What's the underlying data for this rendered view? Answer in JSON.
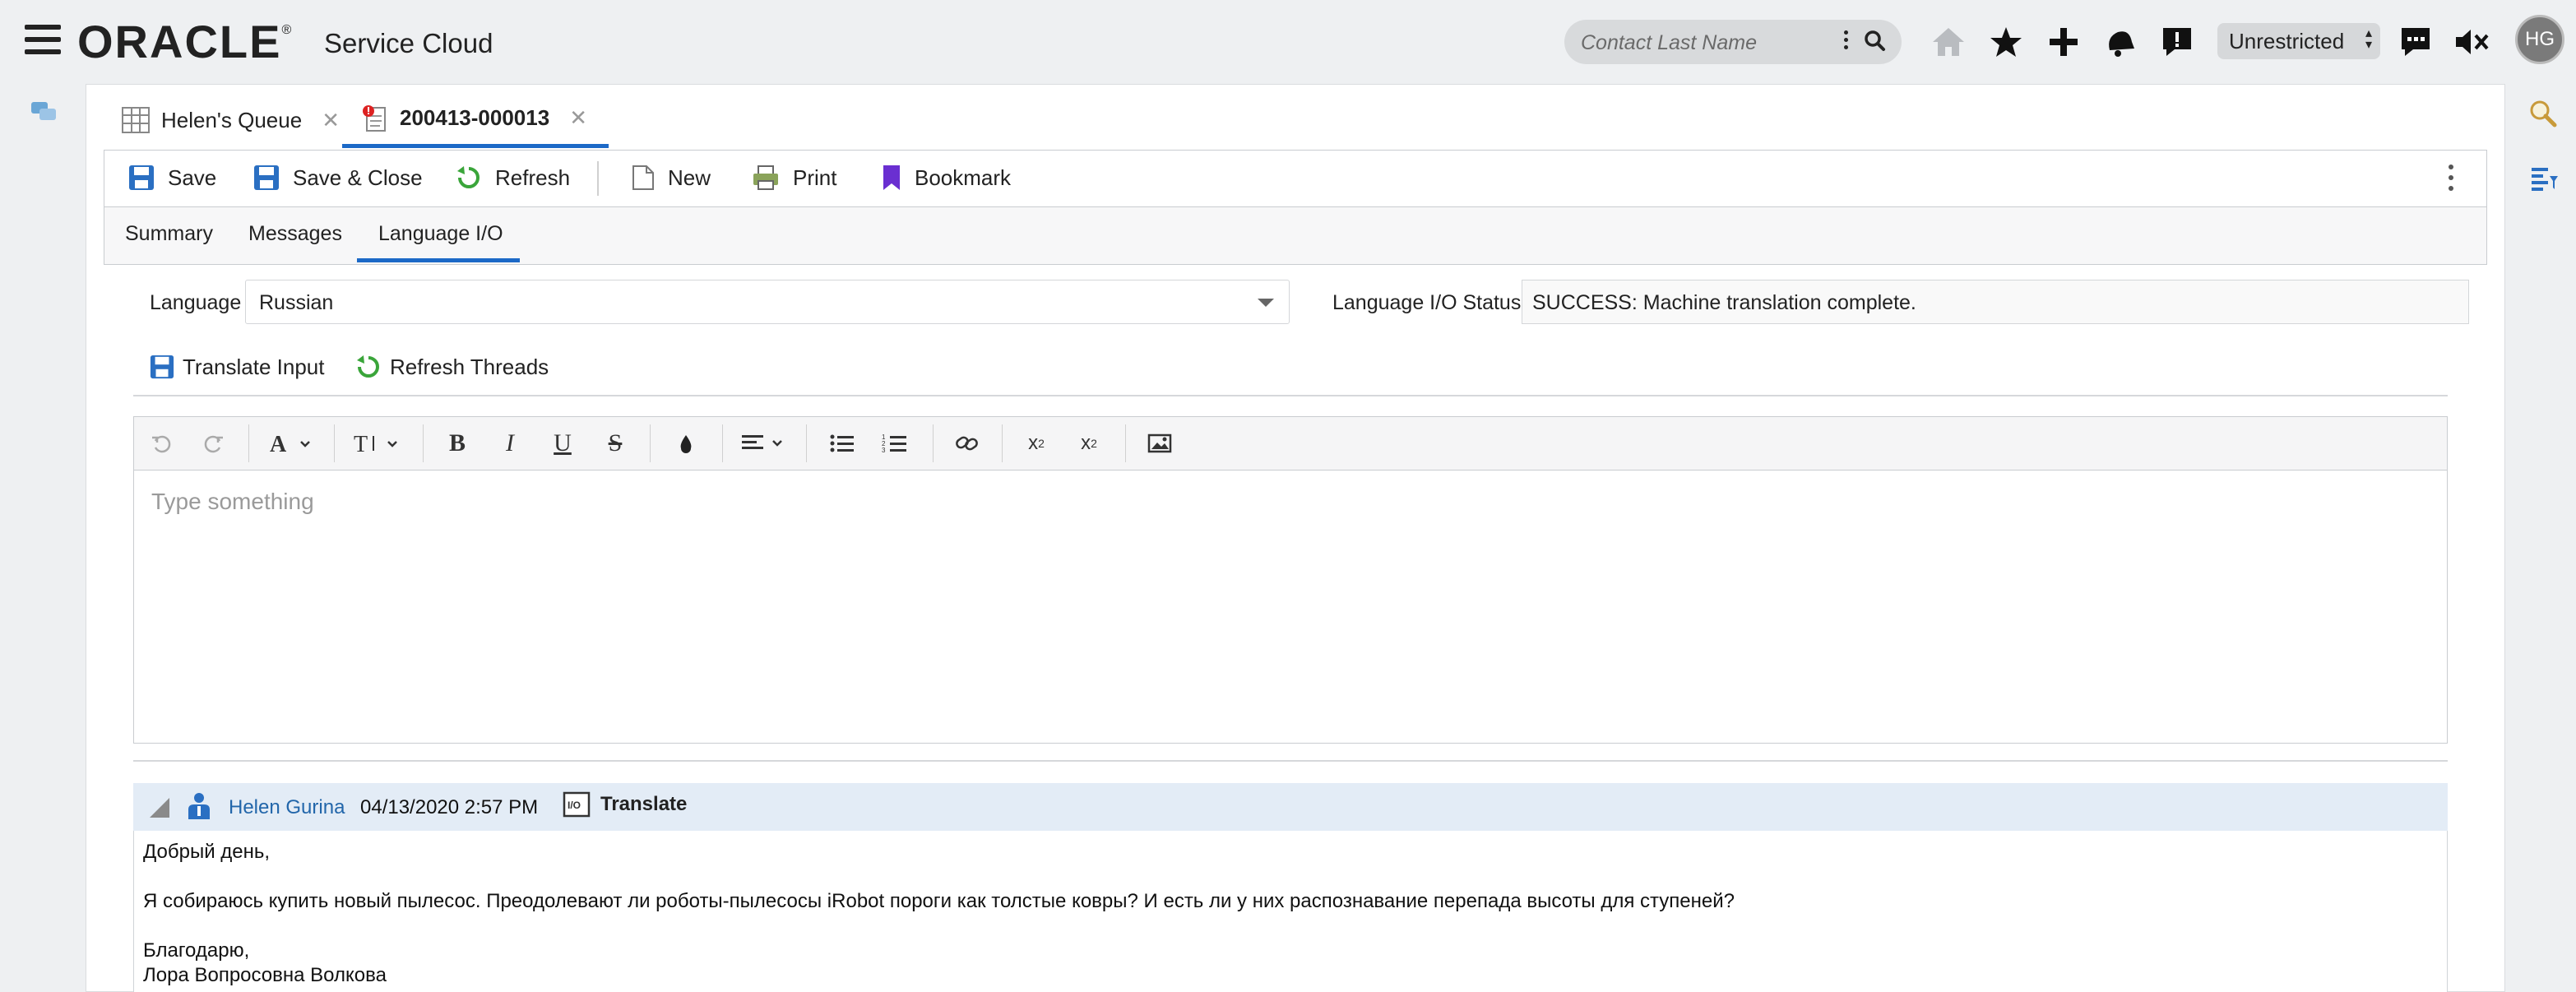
{
  "app": {
    "brand": "ORACLE",
    "brand_mark": "®",
    "product": "Service Cloud"
  },
  "header": {
    "search_placeholder": "Contact Last Name",
    "access_level": "Unrestricted",
    "avatar_initials": "HG",
    "icons": [
      "home-icon",
      "star-icon",
      "plus-icon",
      "notification-bell-icon",
      "report-icon",
      "feedback-icon",
      "mute-icon"
    ]
  },
  "workspace_tabs": [
    {
      "label": "Helen's Queue",
      "icon": "table-icon"
    },
    {
      "label": "200413-000013",
      "icon": "incident-icon",
      "active": true
    }
  ],
  "toolbar": {
    "save": "Save",
    "save_close": "Save & Close",
    "refresh": "Refresh",
    "new": "New",
    "print": "Print",
    "bookmark": "Bookmark"
  },
  "subtabs": [
    "Summary",
    "Messages",
    "Language I/O"
  ],
  "language_io": {
    "language_label": "Language",
    "language_value": "Russian",
    "status_label": "Language I/O Status",
    "status_value": "SUCCESS: Machine translation complete.",
    "translate_input": "Translate Input",
    "refresh_threads": "Refresh Threads"
  },
  "editor": {
    "placeholder": "Type something"
  },
  "thread": {
    "author": "Helen Gurina",
    "timestamp": "04/13/2020 2:57 PM",
    "translate_label": "Translate",
    "lines": [
      "Добрый день,",
      "Я собираюсь купить новый пылесос. Преодолевают ли роботы-пылесосы iRobot пороги как толстые ковры? И есть ли у них распознавание перепада высоты для ступеней?",
      "Благодарю,",
      "Лора Вопросовна Волкова"
    ]
  },
  "colors": {
    "accent": "#1c69c7",
    "save_icon": "#2a6fc2",
    "refresh_icon": "#3aa53a",
    "bookmark_icon": "#6a2fd1",
    "thread_header_bg": "#e3ecf6",
    "author_link": "#2266aa"
  }
}
